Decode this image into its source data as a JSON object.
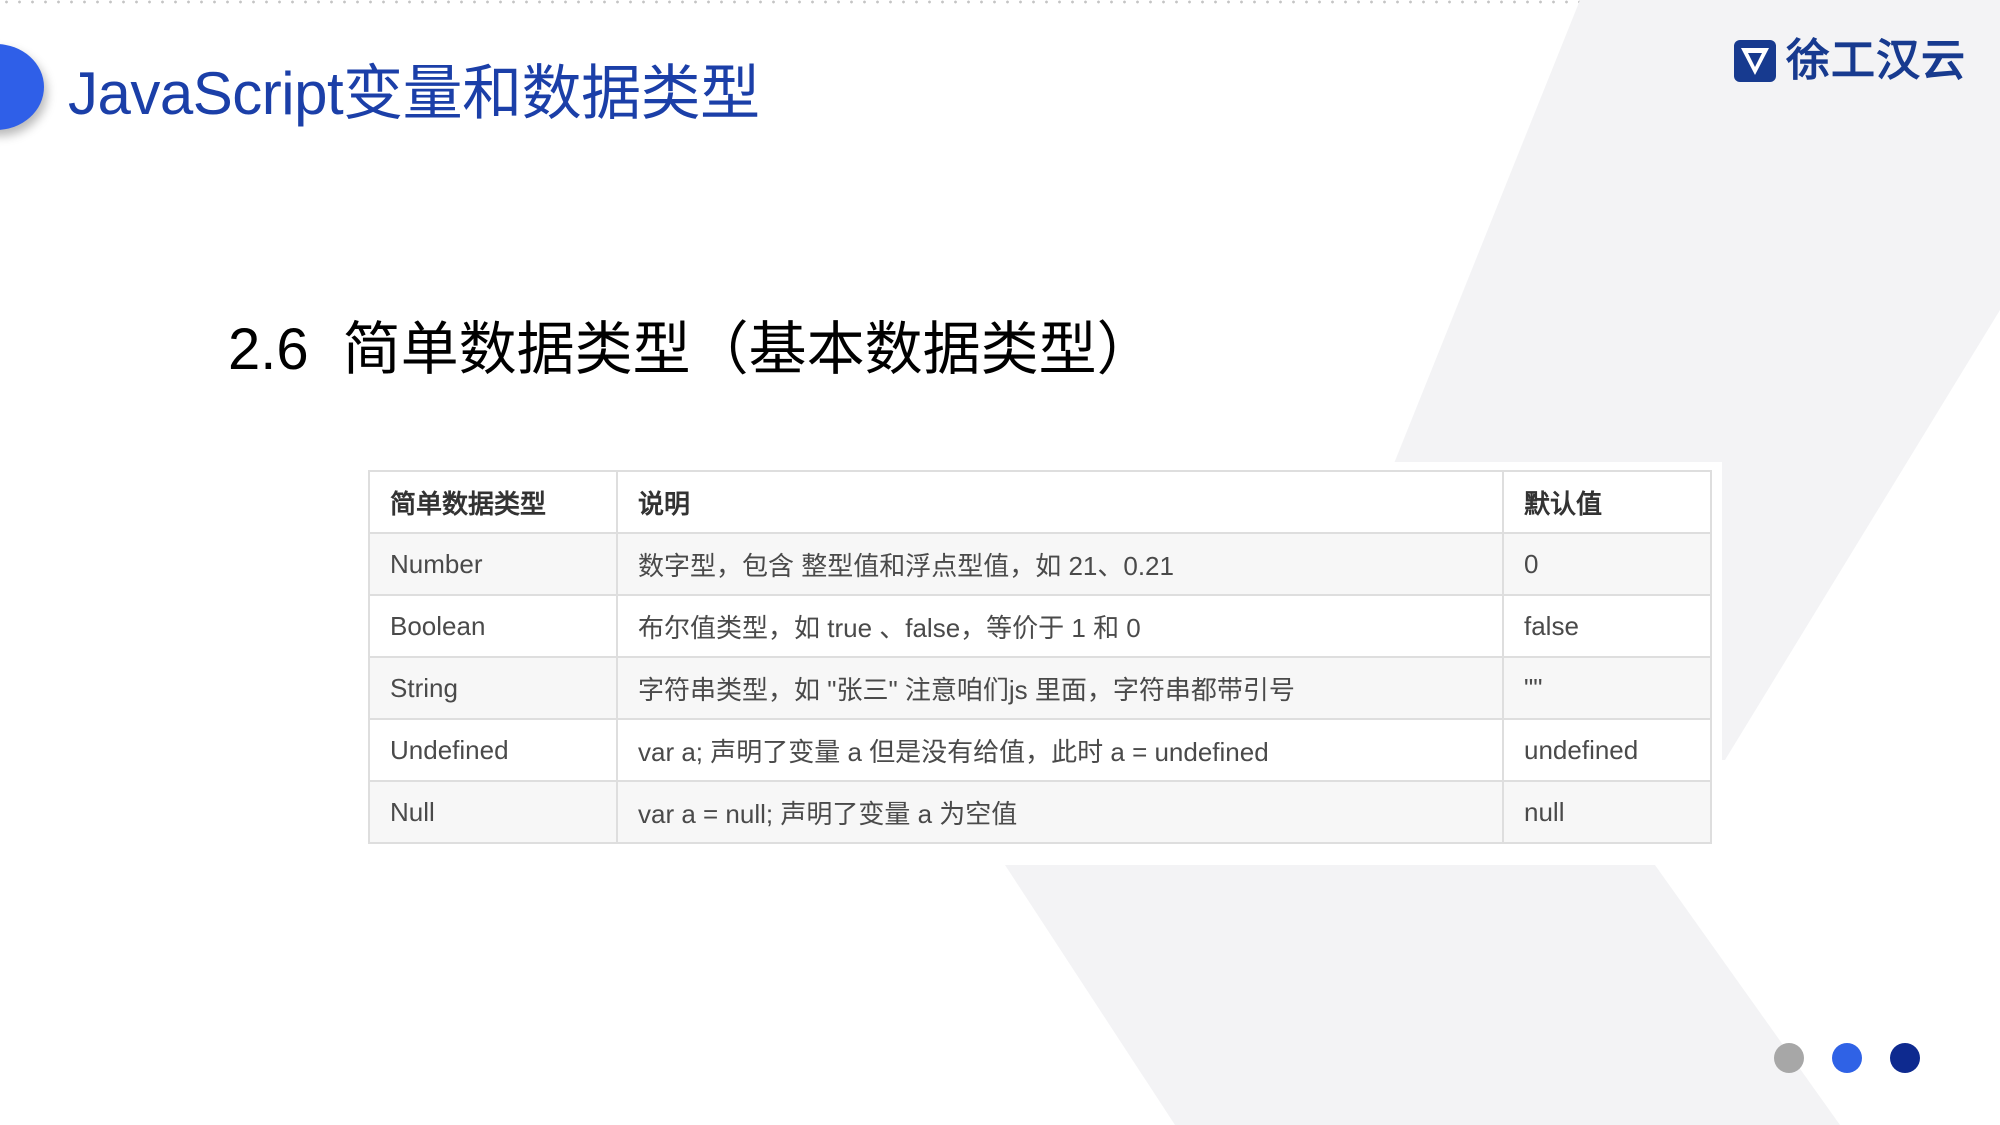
{
  "header": {
    "title": "JavaScript变量和数据类型"
  },
  "logo": {
    "text": "徐工汉云",
    "color": "#173a8f",
    "icon": "xcmg-shield-icon"
  },
  "section": {
    "number": "2.6",
    "heading": "简单数据类型（基本数据类型）"
  },
  "table": {
    "columns": [
      "简单数据类型",
      "说明",
      "默认值"
    ],
    "rows": [
      {
        "type": "Number",
        "desc": "数字型，包含 整型值和浮点型值，如 21、0.21",
        "default": "0"
      },
      {
        "type": "Boolean",
        "desc": "布尔值类型，如 true 、false，等价于 1 和 0",
        "default": "false"
      },
      {
        "type": "String",
        "desc": "字符串类型，如 \"张三\"  注意咱们js 里面，字符串都带引号",
        "default": "\"\""
      },
      {
        "type": "Undefined",
        "desc": "var a;  声明了变量 a 但是没有给值，此时 a = undefined",
        "default": "undefined"
      },
      {
        "type": "Null",
        "desc": "var a = null;  声明了变量 a  为空值",
        "default": "null"
      }
    ]
  },
  "pagination": {
    "dots": [
      "#a7a7a7",
      "#2f62e6",
      "#0e2a8f"
    ]
  },
  "colors": {
    "title": "#1b3fa8",
    "accent": "#2f5fe8",
    "table_border": "#dedede",
    "table_stripe": "#f7f7f7"
  }
}
